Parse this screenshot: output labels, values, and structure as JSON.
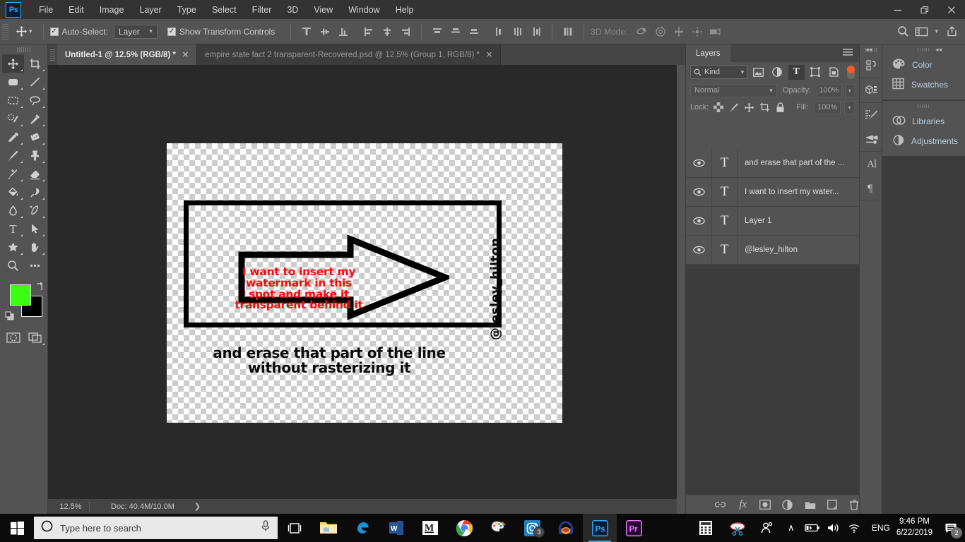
{
  "app": {
    "name": "Adobe Photoshop",
    "logo_text": "Ps"
  },
  "menubar": {
    "items": [
      "File",
      "Edit",
      "Image",
      "Layer",
      "Type",
      "Select",
      "Filter",
      "3D",
      "View",
      "Window",
      "Help"
    ],
    "window_controls": {
      "minimize": "—",
      "restore": "❐",
      "close": "✕"
    }
  },
  "options_bar": {
    "tool": "move-tool",
    "auto_select_label": "Auto-Select:",
    "auto_select_checked": "✓",
    "auto_select_value": "Layer",
    "show_transform_label": "Show Transform Controls",
    "show_transform_checked": "✓",
    "three_d_mode_label": "3D Mode:",
    "align_icons": [
      "align-top-edges-icon",
      "align-vertical-centers-icon",
      "align-bottom-edges-icon",
      "align-left-edges-icon",
      "align-horizontal-centers-icon",
      "align-right-edges-icon"
    ],
    "distribute_icons": [
      "distribute-top-edges-icon",
      "distribute-vertical-centers-icon",
      "distribute-bottom-edges-icon",
      "distribute-left-edges-icon",
      "distribute-horizontal-centers-icon",
      "distribute-right-edges-icon"
    ],
    "extra_icons": [
      "distribute-spacing-icon"
    ],
    "three_d_icons": [
      "3d-orbit-icon",
      "3d-roll-icon",
      "3d-pan-icon",
      "3d-slide-icon",
      "3d-camera-icon"
    ],
    "right_icons": [
      "search-icon",
      "workspace-icon",
      "chevron-down-icon",
      "share-icon"
    ]
  },
  "toolbar": {
    "tools": [
      {
        "name": "move-tool",
        "selected": true
      },
      {
        "name": "crop-tool",
        "selected": false
      },
      {
        "name": "rounded-rectangle-tool",
        "selected": false
      },
      {
        "name": "line-tool",
        "selected": false
      },
      {
        "name": "rectangular-marquee-tool",
        "selected": false
      },
      {
        "name": "lasso-tool",
        "selected": false
      },
      {
        "name": "quick-selection-tool",
        "selected": false
      },
      {
        "name": "magic-wand-tool",
        "selected": false
      },
      {
        "name": "eyedropper-tool",
        "selected": false
      },
      {
        "name": "patch-tool",
        "selected": false
      },
      {
        "name": "brush-tool",
        "selected": false
      },
      {
        "name": "clone-stamp-tool",
        "selected": false
      },
      {
        "name": "healing-brush-tool",
        "selected": false
      },
      {
        "name": "eraser-tool",
        "selected": false
      },
      {
        "name": "paint-bucket-tool",
        "selected": false
      },
      {
        "name": "dodge-tool",
        "selected": false
      },
      {
        "name": "blur-tool",
        "selected": false
      },
      {
        "name": "pen-tool",
        "selected": false
      },
      {
        "name": "type-tool",
        "selected": false
      },
      {
        "name": "path-selection-tool",
        "selected": false
      },
      {
        "name": "custom-shape-tool",
        "selected": false
      },
      {
        "name": "hand-tool",
        "selected": false
      },
      {
        "name": "zoom-tool",
        "selected": false
      },
      {
        "name": "edit-toolbar-tool",
        "selected": false
      }
    ],
    "foreground_color": "#39ff14",
    "background_color": "#000000"
  },
  "tabs": [
    {
      "title": "Untitled-1 @ 12.5% (RGB/8) *",
      "active": true,
      "close": "✕"
    },
    {
      "title": "empire state fact 2 transparent-Recovered.psd @ 12.5% (Group 1, RGB/8) *",
      "active": false,
      "close": "✕"
    }
  ],
  "canvas": {
    "artwork": {
      "red_text_lines": [
        "I want to insert my",
        "watermark in this",
        "spot and make it",
        "transparent behind it"
      ],
      "red_text_color": "#f90a0a",
      "black_text_lines": [
        "and erase that part of the line",
        "without rasterizing it"
      ],
      "black_text_color": "#0a0a0a",
      "vertical_text": "@lesley_hilton"
    }
  },
  "status_bar": {
    "zoom": "12.5%",
    "doc_info": "Doc: 40.4M/10.0M",
    "expand_arrow": "❯"
  },
  "layers_panel": {
    "tab_label": "Layers",
    "filter_kind": "Kind",
    "filter_buttons": [
      "pixel-layer-filter-icon",
      "adjustment-layer-filter-icon",
      "type-layer-filter-icon",
      "shape-layer-filter-icon",
      "smart-object-filter-icon"
    ],
    "active_filter": "type-layer-filter-icon",
    "blend_mode": "Normal",
    "opacity_label": "Opacity:",
    "opacity_value": "100%",
    "lock_label": "Lock:",
    "lock_buttons": [
      "lock-transparent-pixels-icon",
      "lock-image-pixels-icon",
      "lock-position-icon",
      "lock-artboard-nesting-icon",
      "lock-all-icon"
    ],
    "fill_label": "Fill:",
    "fill_value": "100%",
    "layers": [
      {
        "name": "and erase that part of the ...",
        "type": "T",
        "visible": true
      },
      {
        "name": "I want to insert my water...",
        "type": "T",
        "visible": true
      },
      {
        "name": "Layer 1",
        "type": "T",
        "visible": true
      },
      {
        "name": "@lesley_hilton",
        "type": "T",
        "visible": true
      }
    ],
    "bottom_buttons": [
      "link-layers-icon",
      "layer-style-icon",
      "layer-mask-icon",
      "new-adjustment-layer-icon",
      "new-group-icon",
      "new-layer-icon",
      "delete-layer-icon"
    ]
  },
  "right_rail": {
    "icons": [
      "history-icon",
      "3d-panel-icon",
      "brush-settings-icon",
      "brush-presets-icon",
      "character-panel-icon",
      "paragraph-panel-icon"
    ]
  },
  "right_dock": {
    "groups": [
      {
        "items": [
          {
            "label": "Color",
            "icon": "color-palette-icon"
          },
          {
            "label": "Swatches",
            "icon": "swatches-grid-icon"
          }
        ]
      },
      {
        "items": [
          {
            "label": "Libraries",
            "icon": "libraries-cc-icon"
          },
          {
            "label": "Adjustments",
            "icon": "adjustments-half-circle-icon"
          }
        ]
      }
    ],
    "collapse_arrows": "◂◂"
  },
  "taskbar": {
    "search_placeholder": "Type here to search",
    "icons": [
      {
        "name": "task-view-icon"
      },
      {
        "name": "file-explorer-icon"
      },
      {
        "name": "microsoft-edge-icon"
      },
      {
        "name": "microsoft-word-icon"
      },
      {
        "name": "m-app-icon"
      },
      {
        "name": "google-chrome-icon"
      },
      {
        "name": "paint-icon"
      },
      {
        "name": "instagram-icon",
        "badge": "3"
      },
      {
        "name": "headphones-app-icon"
      },
      {
        "name": "photoshop-icon",
        "active": true
      },
      {
        "name": "premiere-pro-icon"
      }
    ],
    "tray": {
      "calculator_icon": "calculator-icon",
      "snip_icon": "snipping-tool-icon",
      "people_icon": "people-icon",
      "chevron_up": "∧",
      "battery_icon": "battery-charging-icon",
      "volume_icon": "volume-icon",
      "wifi_icon": "wifi-icon",
      "language": "ENG",
      "time": "9:46 PM",
      "date": "6/22/2019",
      "notification_count": "2"
    }
  }
}
